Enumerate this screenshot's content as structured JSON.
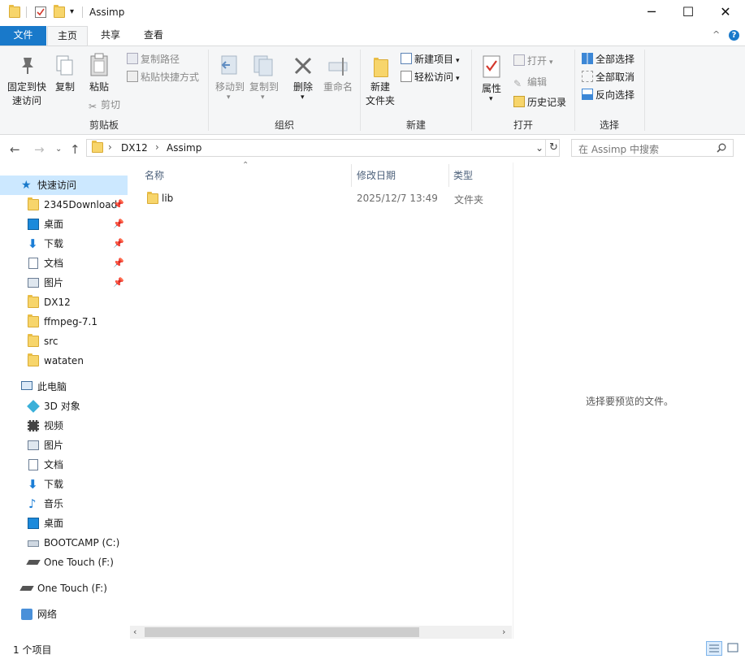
{
  "window": {
    "title": "Assimp",
    "minimize": "─",
    "maximize": "☐",
    "close": "✕"
  },
  "tabs": {
    "file": "文件",
    "home": "主页",
    "share": "共享",
    "view": "查看",
    "collapse": "^",
    "help": "?"
  },
  "ribbon": {
    "pin_label": "固定到快\n速访问",
    "copy": "复制",
    "paste": "粘贴",
    "copy_path": "复制路径",
    "paste_shortcut": "粘贴快捷方式",
    "cut": "剪切",
    "group_clipboard": "剪贴板",
    "move_to": "移动到",
    "copy_to": "复制到",
    "delete": "删除",
    "rename": "重命名",
    "group_organize": "组织",
    "new_folder": "新建\n文件夹",
    "new_item": "新建项目",
    "easy_access": "轻松访问",
    "group_new": "新建",
    "properties": "属性",
    "open": "打开",
    "edit": "编辑",
    "history": "历史记录",
    "group_open": "打开",
    "select_all": "全部选择",
    "select_none": "全部取消",
    "invert": "反向选择",
    "group_select": "选择"
  },
  "address": {
    "crumbs": [
      "DX12",
      "Assimp"
    ],
    "search_placeholder": "在 Assimp 中搜索"
  },
  "nav": {
    "quick_access": "快速访问",
    "quick_items": [
      {
        "label": "2345Download",
        "pinned": true
      },
      {
        "label": "桌面",
        "pinned": true
      },
      {
        "label": "下载",
        "pinned": true
      },
      {
        "label": "文档",
        "pinned": true
      },
      {
        "label": "图片",
        "pinned": true
      },
      {
        "label": "DX12",
        "pinned": false
      },
      {
        "label": "ffmpeg-7.1",
        "pinned": false
      },
      {
        "label": "src",
        "pinned": false
      },
      {
        "label": "wataten",
        "pinned": false
      }
    ],
    "this_pc": "此电脑",
    "pc_items": [
      "3D 对象",
      "视频",
      "图片",
      "文档",
      "下载",
      "音乐",
      "桌面",
      "BOOTCAMP (C:)",
      "One Touch (F:)"
    ],
    "one_touch": "One Touch (F:)",
    "network": "网络"
  },
  "columns": {
    "name": "名称",
    "modified": "修改日期",
    "type": "类型"
  },
  "files": [
    {
      "name": "lib",
      "modified": "2025/12/7 13:49",
      "type": "文件夹"
    }
  ],
  "preview": {
    "empty_text": "选择要预览的文件。"
  },
  "status": {
    "count": "1 个项目"
  },
  "colors": {
    "file_tab": "#1979ca",
    "folder": "#f7d56b",
    "selected_nav": "#cce8ff"
  }
}
